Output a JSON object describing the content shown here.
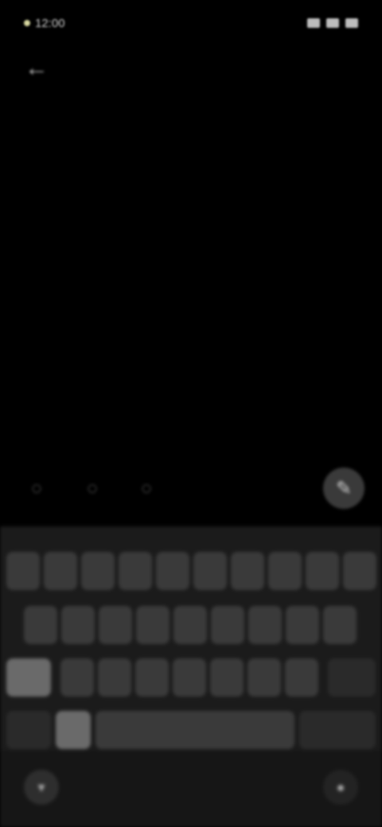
{
  "status_bar": {
    "time": "12:00",
    "right_icons": [
      "signal-icon",
      "wifi-icon",
      "battery-icon"
    ]
  },
  "top_bar": {
    "back_icon": "arrow-back-icon",
    "title": ""
  },
  "post": {
    "title": "",
    "link": "",
    "meta": ""
  },
  "actions": {
    "items": [
      "comment-icon",
      "share-icon",
      "bookmark-icon"
    ],
    "fab_icon": "edit-icon"
  },
  "keyboard": {
    "row1": [
      "",
      "",
      "",
      "",
      "",
      "",
      "",
      "",
      "",
      ""
    ],
    "row2": [
      "",
      "",
      "",
      "",
      "",
      "",
      "",
      "",
      ""
    ],
    "row3": [
      "",
      "",
      "",
      "",
      "",
      "",
      "",
      "",
      ""
    ],
    "row4": [
      "",
      "",
      "",
      ""
    ],
    "nav_left_icon": "keyboard-hide-icon",
    "nav_right_icon": "mic-icon"
  },
  "colors": {
    "background": "#000000",
    "link": "#1f8a3a",
    "keyboard_bg": "#1b1b1b",
    "key_bg": "#3a3a3a"
  }
}
